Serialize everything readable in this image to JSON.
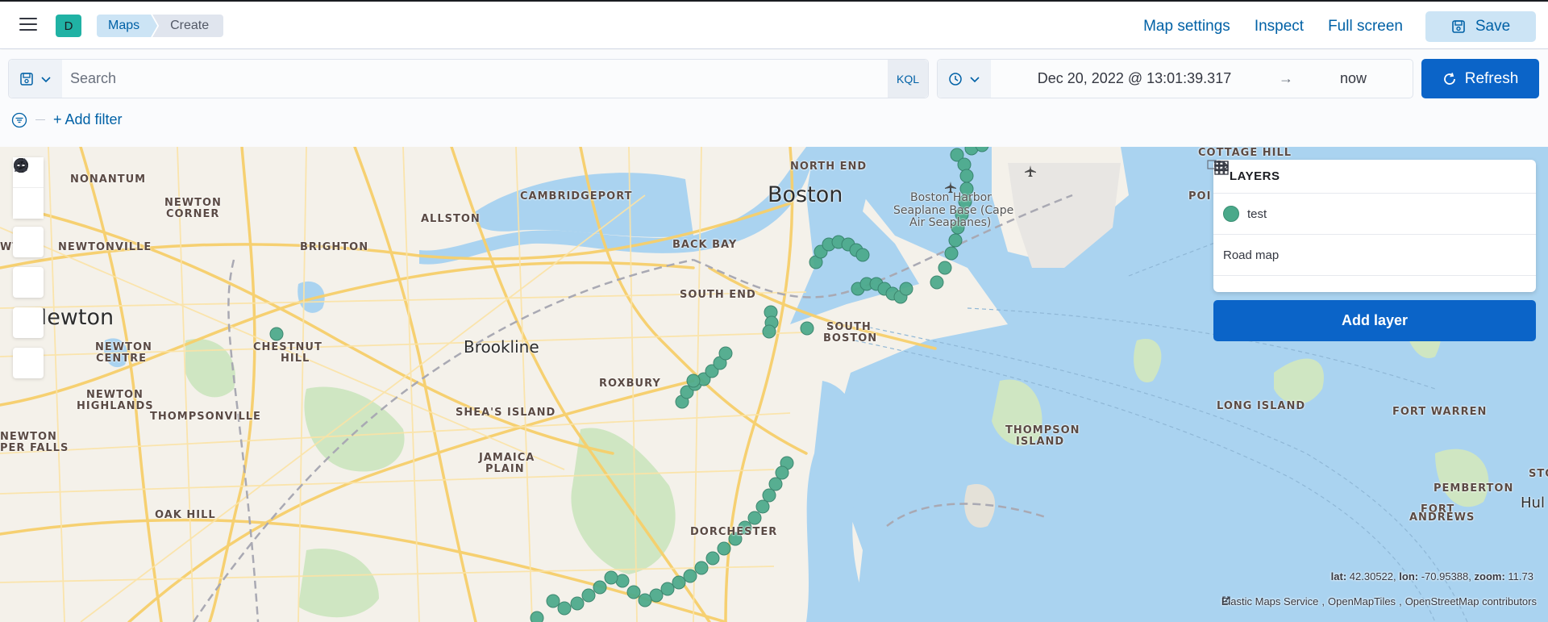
{
  "header": {
    "space_initial": "D",
    "breadcrumbs": [
      "Maps",
      "Create"
    ],
    "links": {
      "map_settings": "Map settings",
      "inspect": "Inspect",
      "full_screen": "Full screen"
    },
    "save_label": "Save"
  },
  "query": {
    "search_placeholder": "Search",
    "language_label": "KQL",
    "date_start": "Dec 20, 2022 @ 13:01:39.317",
    "date_arrow": "→",
    "date_end": "now",
    "refresh_label": "Refresh",
    "add_filter_label": "+ Add filter"
  },
  "map": {
    "labels": {
      "boston": "Boston",
      "newton": "Newton",
      "brookline": "Brookline",
      "cambridgeport": "CAMBRIDGEPORT",
      "north_end": "NORTH END",
      "back_bay": "BACK BAY",
      "south_end": "SOUTH END",
      "south_boston_1": "SOUTH",
      "south_boston_2": "BOSTON",
      "roxbury": "ROXBURY",
      "allston": "ALLSTON",
      "brighton": "BRIGHTON",
      "nonantum": "NONANTUM",
      "newton_corner_1": "NEWTON",
      "newton_corner_2": "CORNER",
      "newtonville": "NEWTONVILLE",
      "chestnut_hill_1": "CHESTNUT",
      "chestnut_hill_2": "HILL",
      "newton_centre_1": "NEWTON",
      "newton_centre_2": "CENTRE",
      "newton_highlands_1": "NEWTON",
      "newton_highlands_2": "HIGHLANDS",
      "thompsonville": "THOMPSONVILLE",
      "newton_upper_falls_1": "NEWTON",
      "newton_upper_falls_2": "PER FALLS",
      "oak_hill": "OAK HILL",
      "sheas_island": "SHEA'S ISLAND",
      "jamaica_plain_1": "JAMAICA",
      "jamaica_plain_2": "PLAIN",
      "dorchester": "DORCHESTER",
      "thompson_island_1": "THOMPSON",
      "thompson_island_2": "ISLAND",
      "long_island": "LONG ISLAND",
      "fort_warren": "FORT WARREN",
      "cottage_hill": "COTTAGE HILL",
      "point": "POI",
      "pemberton": "PEMBERTON",
      "fort_andrews_1": "FORT",
      "fort_andrews_2": "ANDREWS",
      "hull": "Hul",
      "sto": "STO",
      "ewton": "WTON",
      "harbor_1": "Boston Harbor",
      "harbor_2": "Seaplane Base (Cape",
      "harbor_3": "Air Seaplanes)"
    },
    "layers_title": "LAYERS",
    "layers": [
      {
        "name": "test",
        "type": "points",
        "color": "#4aa98a"
      },
      {
        "name": "Road map",
        "type": "basemap"
      }
    ],
    "add_layer_label": "Add layer",
    "coords": {
      "lat_label": "lat:",
      "lat": "42.30522,",
      "lon_label": "lon:",
      "lon": "-70.95388,",
      "zoom_label": "zoom:",
      "zoom": "11.73"
    },
    "attribution": [
      "Elastic Maps Service",
      "OpenMapTiles",
      "OpenStreetMap contributors"
    ]
  },
  "colors": {
    "accent": "#0b64c8",
    "link": "#0061a6",
    "point": "#4aa98a",
    "water": "#aad3f0",
    "land": "#f4f1ea"
  }
}
